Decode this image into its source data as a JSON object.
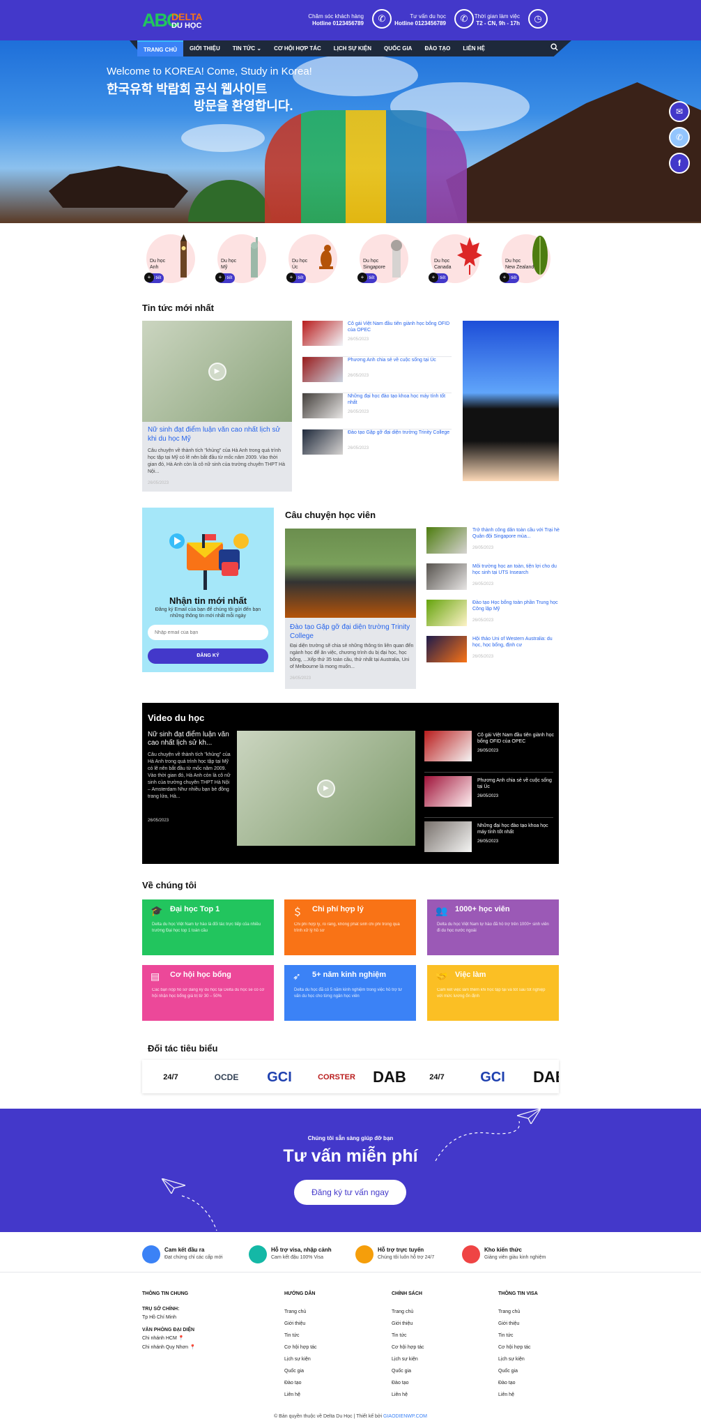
{
  "header": {
    "logo_abc": "ABC",
    "logo_line1": "DELTA",
    "logo_line2": "DU HỌC",
    "contacts": [
      {
        "label": "Chăm sóc khách hàng",
        "value": "Hotline 0123456789",
        "icon": "phone-icon"
      },
      {
        "label": "Tư vấn du học",
        "value": "Hotline 0123456789",
        "icon": "phone-icon"
      },
      {
        "label": "Thời gian làm việc",
        "value": "T2 - CN, 9h - 17h",
        "icon": "clock-icon"
      }
    ]
  },
  "nav": {
    "items": [
      "TRANG CHỦ",
      "GIỚI THIỆU",
      "TIN TỨC ⌄",
      "CƠ HỘI HỢP TÁC",
      "LỊCH SỰ KIỆN",
      "QUỐC GIA",
      "ĐÀO TẠO",
      "LIÊN HỆ"
    ]
  },
  "hero": {
    "line1": "Welcome to KOREA! Come, Study in Korea!",
    "line2": "한국유학 박람회 공식 웹사이트",
    "line3": "방문을 환영합니다."
  },
  "countries": [
    {
      "line1": "Du học",
      "line2": "Anh",
      "cta": "Chi tiết",
      "color": "#fde2e2"
    },
    {
      "line1": "Du học",
      "line2": "Mỹ",
      "cta": "Chi tiết",
      "color": "#fde2e2"
    },
    {
      "line1": "Du học",
      "line2": "Úc",
      "cta": "Chi tiết",
      "color": "#fde2e2"
    },
    {
      "line1": "Du học",
      "line2": "Singapore",
      "cta": "Chi tiết",
      "color": "#fde2e2"
    },
    {
      "line1": "Du học",
      "line2": "Canada",
      "cta": "Chi tiết",
      "color": "#fde2e2"
    },
    {
      "line1": "Du học",
      "line2": "New Zealand",
      "cta": "Chi tiết",
      "color": "#fde2e2"
    }
  ],
  "latest_news": {
    "title": "Tin tức mới nhất",
    "main": {
      "title": "Nữ sinh đạt điểm luận văn cao nhất lịch sử khi du học Mỹ",
      "desc": "Câu chuyện về thành tích \"khủng\" của Hà Anh trong quá trình học tập tại Mỹ có lẽ nên bắt đầu từ mốc năm 2009. Vào thời gian đó, Hà Anh còn là cô nữ sinh của trường chuyên THPT Hà Nội...",
      "date": "26/05/2023"
    },
    "list": [
      {
        "title": "Cô gái Việt Nam đầu tiên giành học bổng OFID của OPEC",
        "date": "26/05/2023"
      },
      {
        "title": "Phương Anh chia sẻ về cuộc sống tại Úc",
        "date": "26/05/2023"
      },
      {
        "title": "Những đại học đào tạo khoa học máy tính tốt nhất",
        "date": "26/05/2023"
      },
      {
        "title": "Đào tạo Gặp gỡ đại diện trường Trinity College",
        "date": "26/05/2023"
      }
    ]
  },
  "newsletter": {
    "title": "Nhận tin mới nhất",
    "desc": "Đăng ký Email của bạn để chúng tôi gửi đến bạn những thông tin mới nhất mỗi ngày",
    "placeholder": "Nhập email của bạn",
    "button": "ĐĂNG KÝ"
  },
  "stories": {
    "title": "Câu chuyện học viên",
    "main": {
      "title": "Đào tạo Gặp gỡ đại diện trường Trinity College",
      "desc": "Đại diện trường sẽ chia sẻ những thông tin liên quan đến ngành học để ăn việc, chương trình du bị đại học, học bổng, ...Xếp thứ 35 toàn cầu, thứ nhất tại Australia, Uni of Melbourne là mong muốn...",
      "date": "26/05/2023"
    },
    "list": [
      {
        "title": "Trở thành công dân toàn cầu với Trại hè Quân đội Singapore mùa...",
        "date": "26/05/2023"
      },
      {
        "title": "Môi trường học an toàn, tiện lợi cho du học sinh tại UTS Insearch",
        "date": "26/05/2023"
      },
      {
        "title": "Đào tạo Học bổng toàn phần Trung học Công lập Mỹ",
        "date": "26/05/2023"
      },
      {
        "title": "Hội thảo Uni of Western Australia: du học, học bổng, định cư",
        "date": "26/05/2023"
      }
    ]
  },
  "video": {
    "title": "Video du học",
    "main": {
      "title": "Nữ sinh đạt điểm luận văn cao nhất lịch sử kh...",
      "desc": "Câu chuyện về thành tích \"khủng\" của Hà Anh trong quá trình học tập tại Mỹ có lẽ nên bắt đầu từ mốc năm 2009. Vào thời gian đó, Hà Anh còn là cô nữ sinh của trường chuyên THPT Hà Nội – Amsterdam Như nhiều bạn bè đồng trang lứa, Hà...",
      "date": "26/05/2023"
    },
    "list": [
      {
        "title": "Cô gái Việt Nam đầu tiên giành học bổng OFID của OPEC",
        "date": "26/05/2023"
      },
      {
        "title": "Phương Anh chia sẻ về cuộc sống tại Úc",
        "date": "26/05/2023"
      },
      {
        "title": "Những đại học đào tạo khoa học máy tính tốt nhất",
        "date": "26/05/2023"
      }
    ]
  },
  "about": {
    "title": "Về chúng tôi",
    "cards": [
      {
        "title": "Đại học Top 1",
        "desc": "Delta du học Việt Nam tự hào là đối tác trực tiếp của nhiều trường Đại học top 1 toàn cầu",
        "color": "#22c55e",
        "icon": "graduation-cap-icon"
      },
      {
        "title": "Chi phí hợp lý",
        "desc": "Chi phí hợp lý, rõ ràng, không phát sinh chi phí trong quá trình xử lý hồ sơ",
        "color": "#f97316",
        "icon": "money-icon"
      },
      {
        "title": "1000+ học viên",
        "desc": "Delta du học Việt Nam tự hào đã hỗ trợ trên 1000+ sinh viên đi du học nước ngoài",
        "color": "#9b59b6",
        "icon": "users-icon"
      },
      {
        "title": "Cơ hội học bổng",
        "desc": "Các bạn nộp hồ sơ đăng ký du học tại Delta du học sẽ có cơ hội nhận học bổng giá trị từ 30 – 50%",
        "color": "#ec4899",
        "icon": "scholarship-icon"
      },
      {
        "title": "5+ năm kinh nghiệm",
        "desc": "Delta du học đã có 5 năm kinh nghiệm trong việc hỗ trợ tư vấn du học cho từng ngân học viên",
        "color": "#3b82f6",
        "icon": "rocket-icon"
      },
      {
        "title": "Việc làm",
        "desc": "Cam kết việc làm thêm khi học tập tại và tốt sau tốt nghiệp với mức lương ổn định",
        "color": "#fbbf24",
        "icon": "handshake-icon"
      }
    ]
  },
  "partners": {
    "title": "Đối tác tiêu biểu",
    "logos": [
      "24/7 fitness",
      "OCDE",
      "GCI",
      "CORSTER",
      "DAB",
      "24/7 fitness",
      "GCI",
      "DAB"
    ]
  },
  "cta": {
    "small": "Chúng tôi sẵn sàng giúp đỡ bạn",
    "big": "Tư vấn miễn phí",
    "button": "Đăng ký tư vấn ngay"
  },
  "features": [
    {
      "title": "Cam kết đầu ra",
      "desc": "Đạt chứng chỉ các cấp mới",
      "color": "#3b82f6"
    },
    {
      "title": "Hỗ trợ visa, nhập cảnh",
      "desc": "Cam kết đậu 100% Visa",
      "color": "#14b8a6"
    },
    {
      "title": "Hỗ trợ trực tuyến",
      "desc": "Chúng tôi luôn hỗ trợ 24/7",
      "color": "#f59e0b"
    },
    {
      "title": "Kho kiến thức",
      "desc": "Giảng viên giàu kinh nghiệm",
      "color": "#ef4444"
    }
  ],
  "footer": {
    "col1": {
      "title": "THÔNG TIN CHUNG",
      "h1": "TRỤ SỞ CHÍNH:",
      "v1": "Tp Hồ Chí Minh",
      "h2": "VĂN PHÒNG ĐẠI DIỆN",
      "v2": "Chi nhánh HCM",
      "v3": "Chi nhánh Quy Nhơn"
    },
    "col2": {
      "title": "HƯỚNG DẪN",
      "links": [
        "Trang chủ",
        "Giới thiệu",
        "Tin tức",
        "Cơ hội hợp tác",
        "Lịch sự kiện",
        "Quốc gia",
        "Đào tạo",
        "Liên hệ"
      ]
    },
    "col3": {
      "title": "CHÍNH SÁCH",
      "links": [
        "Trang chủ",
        "Giới thiệu",
        "Tin tức",
        "Cơ hội hợp tác",
        "Lịch sự kiện",
        "Quốc gia",
        "Đào tạo",
        "Liên hệ"
      ]
    },
    "col4": {
      "title": "THÔNG TIN VISA",
      "links": [
        "Trang chủ",
        "Giới thiệu",
        "Tin tức",
        "Cơ hội hợp tác",
        "Lịch sự kiện",
        "Quốc gia",
        "Đào tạo",
        "Liên hệ"
      ]
    },
    "copyright": "© Bản quyền thuộc về Delta Du Học | Thiết kế bởi",
    "designer": "GIAODIENWP.COM"
  }
}
